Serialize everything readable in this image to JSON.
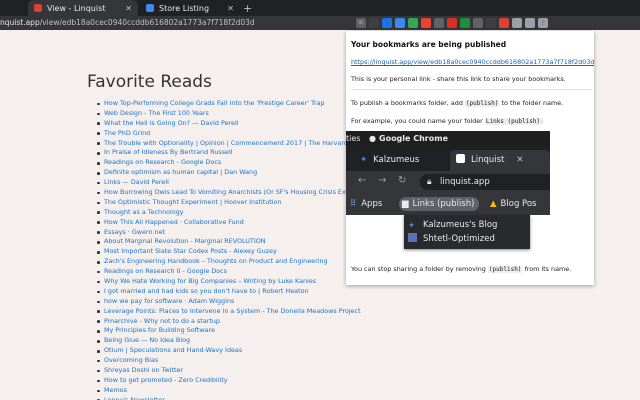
{
  "browser": {
    "tabs": [
      {
        "title": "View - Linquist",
        "active": true
      },
      {
        "title": "Store Listing",
        "active": false
      }
    ],
    "url_host": "nquist.app",
    "url_path": "/view/edb18a0cec0940ccddb616802a1773a7f718f2d03d"
  },
  "page": {
    "title": "Favorite Reads",
    "links": [
      "How Top-Performing College Grads Fall Into the 'Prestige Career' Trap",
      "Web Design - The First 100 Years",
      "What the Hell is Going On? — David Perell",
      "The PhD Grind",
      "The Trouble with Optionality | Opinion | Commencement 2017 | The Harvard",
      "In Praise of Idleness By Bertrand Russell",
      "Readings on Research - Google Docs",
      "Definite optimism as human capital | Dan Wang",
      "Links — David Perell",
      "How Burrowing Owls Lead To Vomiting Anarchists (Or SF's Housing Crisis Exp",
      "The Optimistic Thought Experiment | Hoover Institution",
      "Thought as a Technology",
      "How This All Happened · Collaborative Fund",
      "Essays · Gwern.net",
      "About Marginal Revolution - Marginal REVOLUTION",
      "Most Important Slate Star Codex Posts - Alexey Guzey",
      "Zach's Engineering Handbook – Thoughts on Product and Engineering",
      "Readings on Research II - Google Docs",
      "Why We Hate Working for Big Companies – Writing by Luke Kanies",
      "I got married and had kids so you don't have to | Robert Heaton",
      "how we pay for software · Adam Wiggins",
      "Leverage Points: Places to Intervene in a System - The Donella Meadows Project",
      "Pmarchive - Why not to do a startup",
      "My Principles for Building Software",
      "Being Glue — No Idea Blog",
      "Otium | Speculations and Hand-Wavy Ideas",
      "Overcoming Bias",
      "Shreyas Doshi on Twitter",
      "How to get promoted - Zero Credibility",
      "Memos",
      "Lenny's Newsletter"
    ]
  },
  "popup": {
    "heading": "Your bookmarks are being published",
    "link": "https://linquist.app/view/edb18a0cec0940ccddb616802a1773a7f718f2d03d",
    "personal_note": "This is your personal link - share this link to share your bookmarks.",
    "instr_prefix": "To publish a bookmarks folder, add",
    "instr_code": "(publish)",
    "instr_suffix": "to the folder name.",
    "example_prefix": "For example, you could name your folder",
    "example_code": "Links (publish)",
    "example_suffix": ":",
    "stop_prefix": "You can stop sharing a folder by removing",
    "stop_code": "(publish)",
    "stop_suffix": "from its name.",
    "demo": {
      "menubar_left": "ties",
      "menubar_app": "Google Chrome",
      "tab1": "Kalzumeus",
      "tab2": "Linquist",
      "omnibox": "linquist.app",
      "bm_apps": "Apps",
      "bm_folder": "Links (publish)",
      "bm_blog": "Blog Pos",
      "dropdown": [
        "Kalzumeus's Blog",
        "Shtetl-Optimized"
      ]
    }
  },
  "colors": {
    "link": "#1a73c8",
    "background": "#f5f0ee"
  }
}
